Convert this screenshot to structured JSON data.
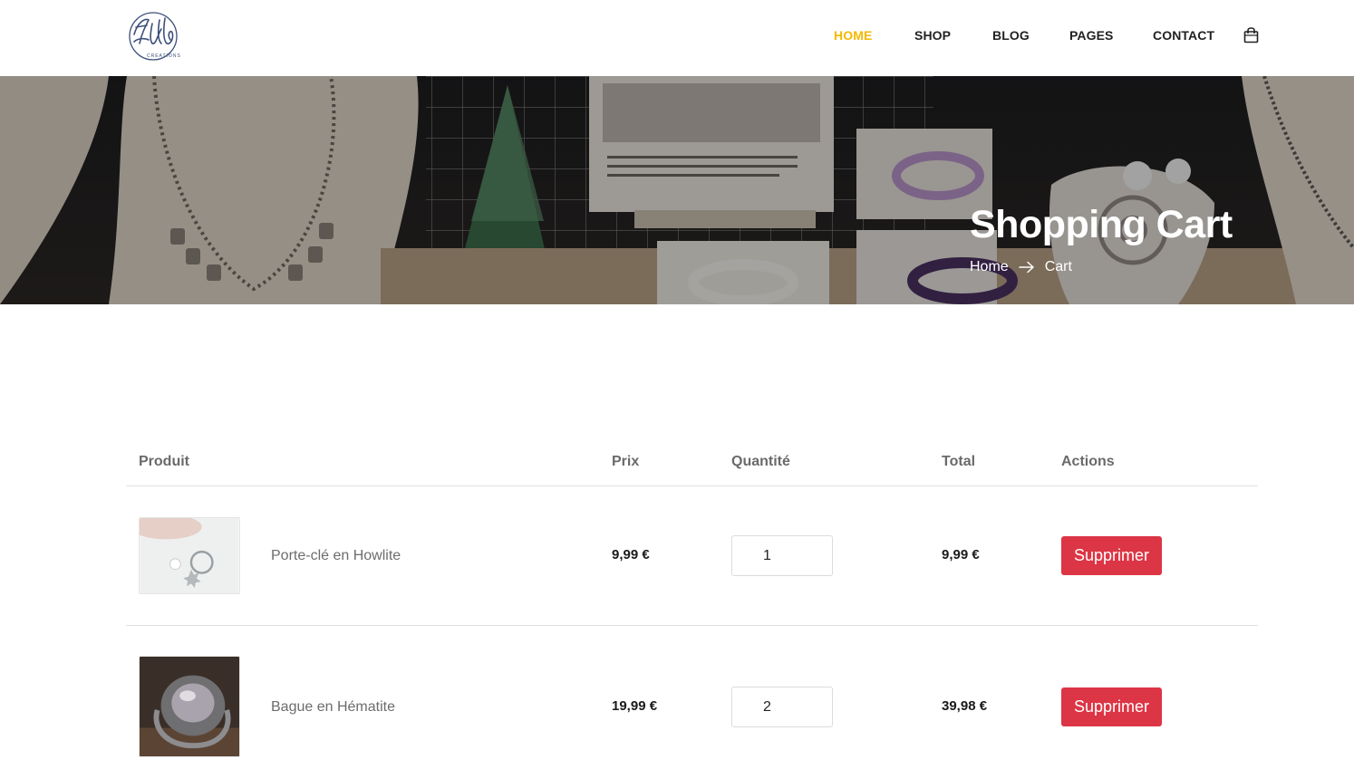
{
  "brand": {
    "logo_text": "Estella",
    "logo_subtext": "CREATIONS"
  },
  "nav": {
    "items": [
      {
        "label": "HOME",
        "active": true
      },
      {
        "label": "SHOP",
        "active": false
      },
      {
        "label": "BLOG",
        "active": false
      },
      {
        "label": "PAGES",
        "active": false
      },
      {
        "label": "CONTACT",
        "active": false
      }
    ],
    "cart_icon": "shopping-bag-icon",
    "active_color": "#f5b800"
  },
  "hero": {
    "title": "Shopping Cart",
    "breadcrumb": {
      "home": "Home",
      "separator_icon": "arrow-right-icon",
      "current": "Cart"
    }
  },
  "cart": {
    "headers": {
      "product": "Produit",
      "price": "Prix",
      "quantity": "Quantité",
      "total": "Total",
      "actions": "Actions"
    },
    "rows": [
      {
        "name": "Porte-clé en Howlite",
        "price": "9,99 €",
        "quantity": "1",
        "total": "9,99 €",
        "action_label": "Supprimer"
      },
      {
        "name": "Bague en Hématite",
        "price": "19,99 €",
        "quantity": "2",
        "total": "39,98 €",
        "action_label": "Supprimer"
      }
    ],
    "delete_color": "#dc3545"
  }
}
